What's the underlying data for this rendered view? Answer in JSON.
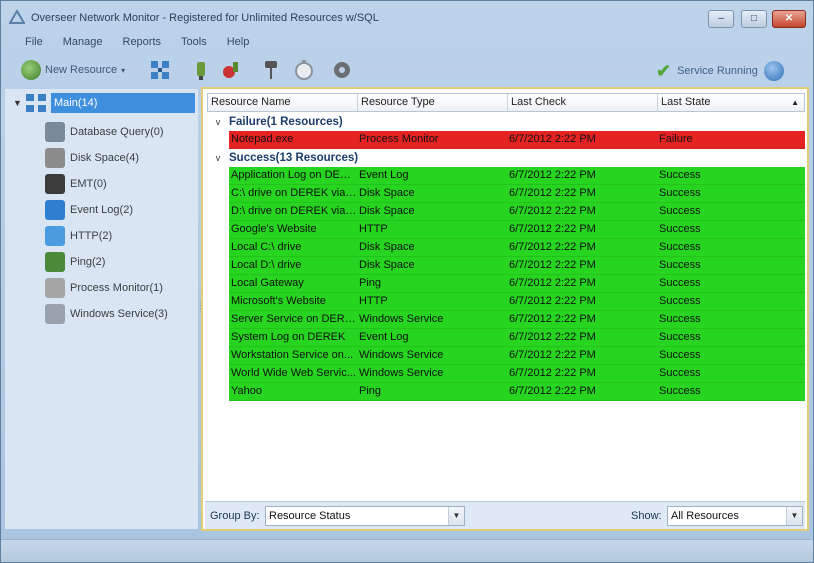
{
  "window": {
    "title": "Overseer Network Monitor - Registered for Unlimited Resources w/SQL",
    "controls": {
      "minimize": "–",
      "maximize": "□",
      "close": "✕"
    }
  },
  "menu": [
    "File",
    "Manage",
    "Reports",
    "Tools",
    "Help"
  ],
  "toolbar": {
    "new_resource": "New Resource",
    "service_status": "Service Running",
    "icons": [
      "network-icon",
      "plug-icon",
      "tools-icon",
      "pin-icon",
      "stopwatch-icon",
      "gear-icon"
    ]
  },
  "tree": {
    "root": "Main(14)",
    "children": [
      {
        "label": "Database Query(0)",
        "icon": "database-icon",
        "color": "#7a8a99"
      },
      {
        "label": "Disk Space(4)",
        "icon": "disk-icon",
        "color": "#8c8c8c"
      },
      {
        "label": "EMT(0)",
        "icon": "terminal-icon",
        "color": "#3b3b3b"
      },
      {
        "label": "Event Log(2)",
        "icon": "eventlog-icon",
        "color": "#2f7fd0"
      },
      {
        "label": "HTTP(2)",
        "icon": "globe-icon",
        "color": "#4b9be0"
      },
      {
        "label": "Ping(2)",
        "icon": "ping-icon",
        "color": "#4a8a3a"
      },
      {
        "label": "Process Monitor(1)",
        "icon": "process-icon",
        "color": "#a6a6a6"
      },
      {
        "label": "Windows Service(3)",
        "icon": "service-icon",
        "color": "#9aa3ad"
      }
    ]
  },
  "grid": {
    "columns": [
      "Resource Name",
      "Resource Type",
      "Last Check",
      "Last State"
    ],
    "groups": [
      {
        "title": "Failure(1 Resources)",
        "status": "failure",
        "rows": [
          [
            "Notepad.exe",
            "Process Monitor",
            "6/7/2012 2:22 PM",
            "Failure"
          ]
        ]
      },
      {
        "title": "Success(13 Resources)",
        "status": "success",
        "rows": [
          [
            "Application Log on DEREK",
            "Event Log",
            "6/7/2012 2:22 PM",
            "Success"
          ],
          [
            "C:\\ drive on DEREK via ...",
            "Disk Space",
            "6/7/2012 2:22 PM",
            "Success"
          ],
          [
            "D:\\ drive on DEREK via ...",
            "Disk Space",
            "6/7/2012 2:22 PM",
            "Success"
          ],
          [
            "Google's Website",
            "HTTP",
            "6/7/2012 2:22 PM",
            "Success"
          ],
          [
            "Local C:\\ drive",
            "Disk Space",
            "6/7/2012 2:22 PM",
            "Success"
          ],
          [
            "Local D:\\ drive",
            "Disk Space",
            "6/7/2012 2:22 PM",
            "Success"
          ],
          [
            "Local Gateway",
            "Ping",
            "6/7/2012 2:22 PM",
            "Success"
          ],
          [
            "Microsoft's Website",
            "HTTP",
            "6/7/2012 2:22 PM",
            "Success"
          ],
          [
            "Server Service on DEREK",
            "Windows Service",
            "6/7/2012 2:22 PM",
            "Success"
          ],
          [
            "System Log on DEREK",
            "Event Log",
            "6/7/2012 2:22 PM",
            "Success"
          ],
          [
            "Workstation Service on...",
            "Windows Service",
            "6/7/2012 2:22 PM",
            "Success"
          ],
          [
            "World Wide Web Servic...",
            "Windows Service",
            "6/7/2012 2:22 PM",
            "Success"
          ],
          [
            "Yahoo",
            "Ping",
            "6/7/2012 2:22 PM",
            "Success"
          ]
        ]
      }
    ]
  },
  "filters": {
    "group_by_label": "Group By:",
    "group_by_value": "Resource Status",
    "show_label": "Show:",
    "show_value": "All Resources"
  },
  "colors": {
    "success": "#27d41f",
    "failure": "#e52323",
    "selection": "#3f8fdf",
    "group_title": "#1b3d6c"
  }
}
